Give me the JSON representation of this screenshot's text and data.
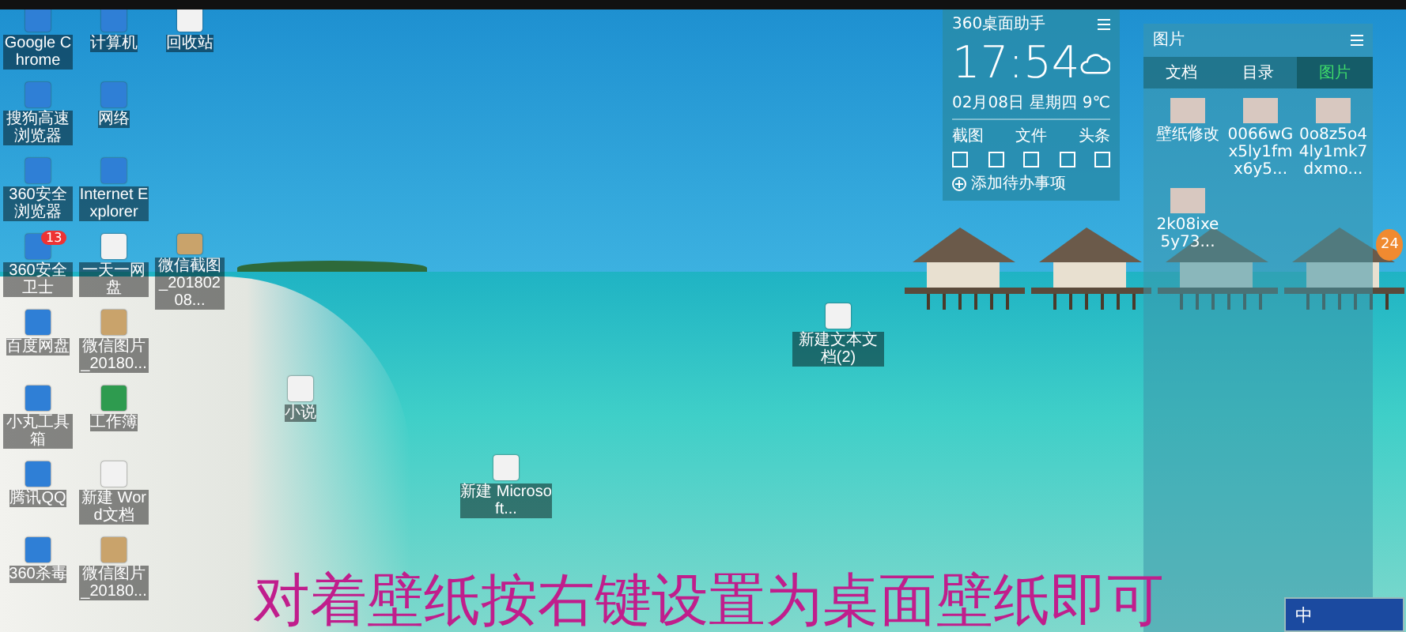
{
  "desktop_columns": [
    [
      {
        "label": "Google Chrome",
        "kind": "app"
      },
      {
        "label": "搜狗高速浏览器",
        "kind": "app"
      },
      {
        "label": "360安全浏览器",
        "kind": "app"
      },
      {
        "label": "360安全卫士",
        "kind": "app",
        "badge": "13"
      },
      {
        "label": "百度网盘",
        "kind": "app"
      },
      {
        "label": "小丸工具箱",
        "kind": "app"
      },
      {
        "label": "腾讯QQ",
        "kind": "app"
      },
      {
        "label": "360杀毒",
        "kind": "app"
      }
    ],
    [
      {
        "label": "计算机",
        "kind": "app"
      },
      {
        "label": "网络",
        "kind": "app"
      },
      {
        "label": "Internet Explorer",
        "kind": "app"
      },
      {
        "label": "一天一网盘",
        "kind": "doc"
      },
      {
        "label": "微信图片_20180...",
        "kind": "image"
      },
      {
        "label": "工作簿",
        "kind": "sheet"
      },
      {
        "label": "新建 Word文档",
        "kind": "doc"
      },
      {
        "label": "微信图片_20180...",
        "kind": "image"
      }
    ],
    [
      {
        "label": "回收站",
        "kind": "doc"
      },
      {
        "kind": "none"
      },
      {
        "kind": "none"
      },
      {
        "label": "微信截图_20180208...",
        "kind": "image"
      }
    ]
  ],
  "scattered_icons": [
    {
      "label": "新建文本文档(2)",
      "kind": "doc"
    },
    {
      "label": "小说",
      "kind": "doc"
    },
    {
      "label": "新建 Microsoft...",
      "kind": "doc"
    }
  ],
  "clock_widget": {
    "title": "360桌面助手",
    "time": "17:54",
    "date": "02月08日",
    "weekday": "星期四",
    "temperature": "9℃",
    "actions": [
      "截图",
      "文件",
      "头条"
    ],
    "todo": "添加待办事项"
  },
  "picture_panel": {
    "title": "图片",
    "tabs": [
      {
        "label": "文档",
        "selected": false
      },
      {
        "label": "目录",
        "selected": false
      },
      {
        "label": "图片",
        "selected": true
      }
    ],
    "items": [
      "壁纸修改",
      "0066wGx5ly1fmx6y5...",
      "0o8z5o44ly1mk7dxmo...",
      "2k08ixe5y73..."
    ]
  },
  "side_badge": "24",
  "caption": "对着壁纸按右键设置为桌面壁纸即可",
  "ime": {
    "label": "中"
  }
}
